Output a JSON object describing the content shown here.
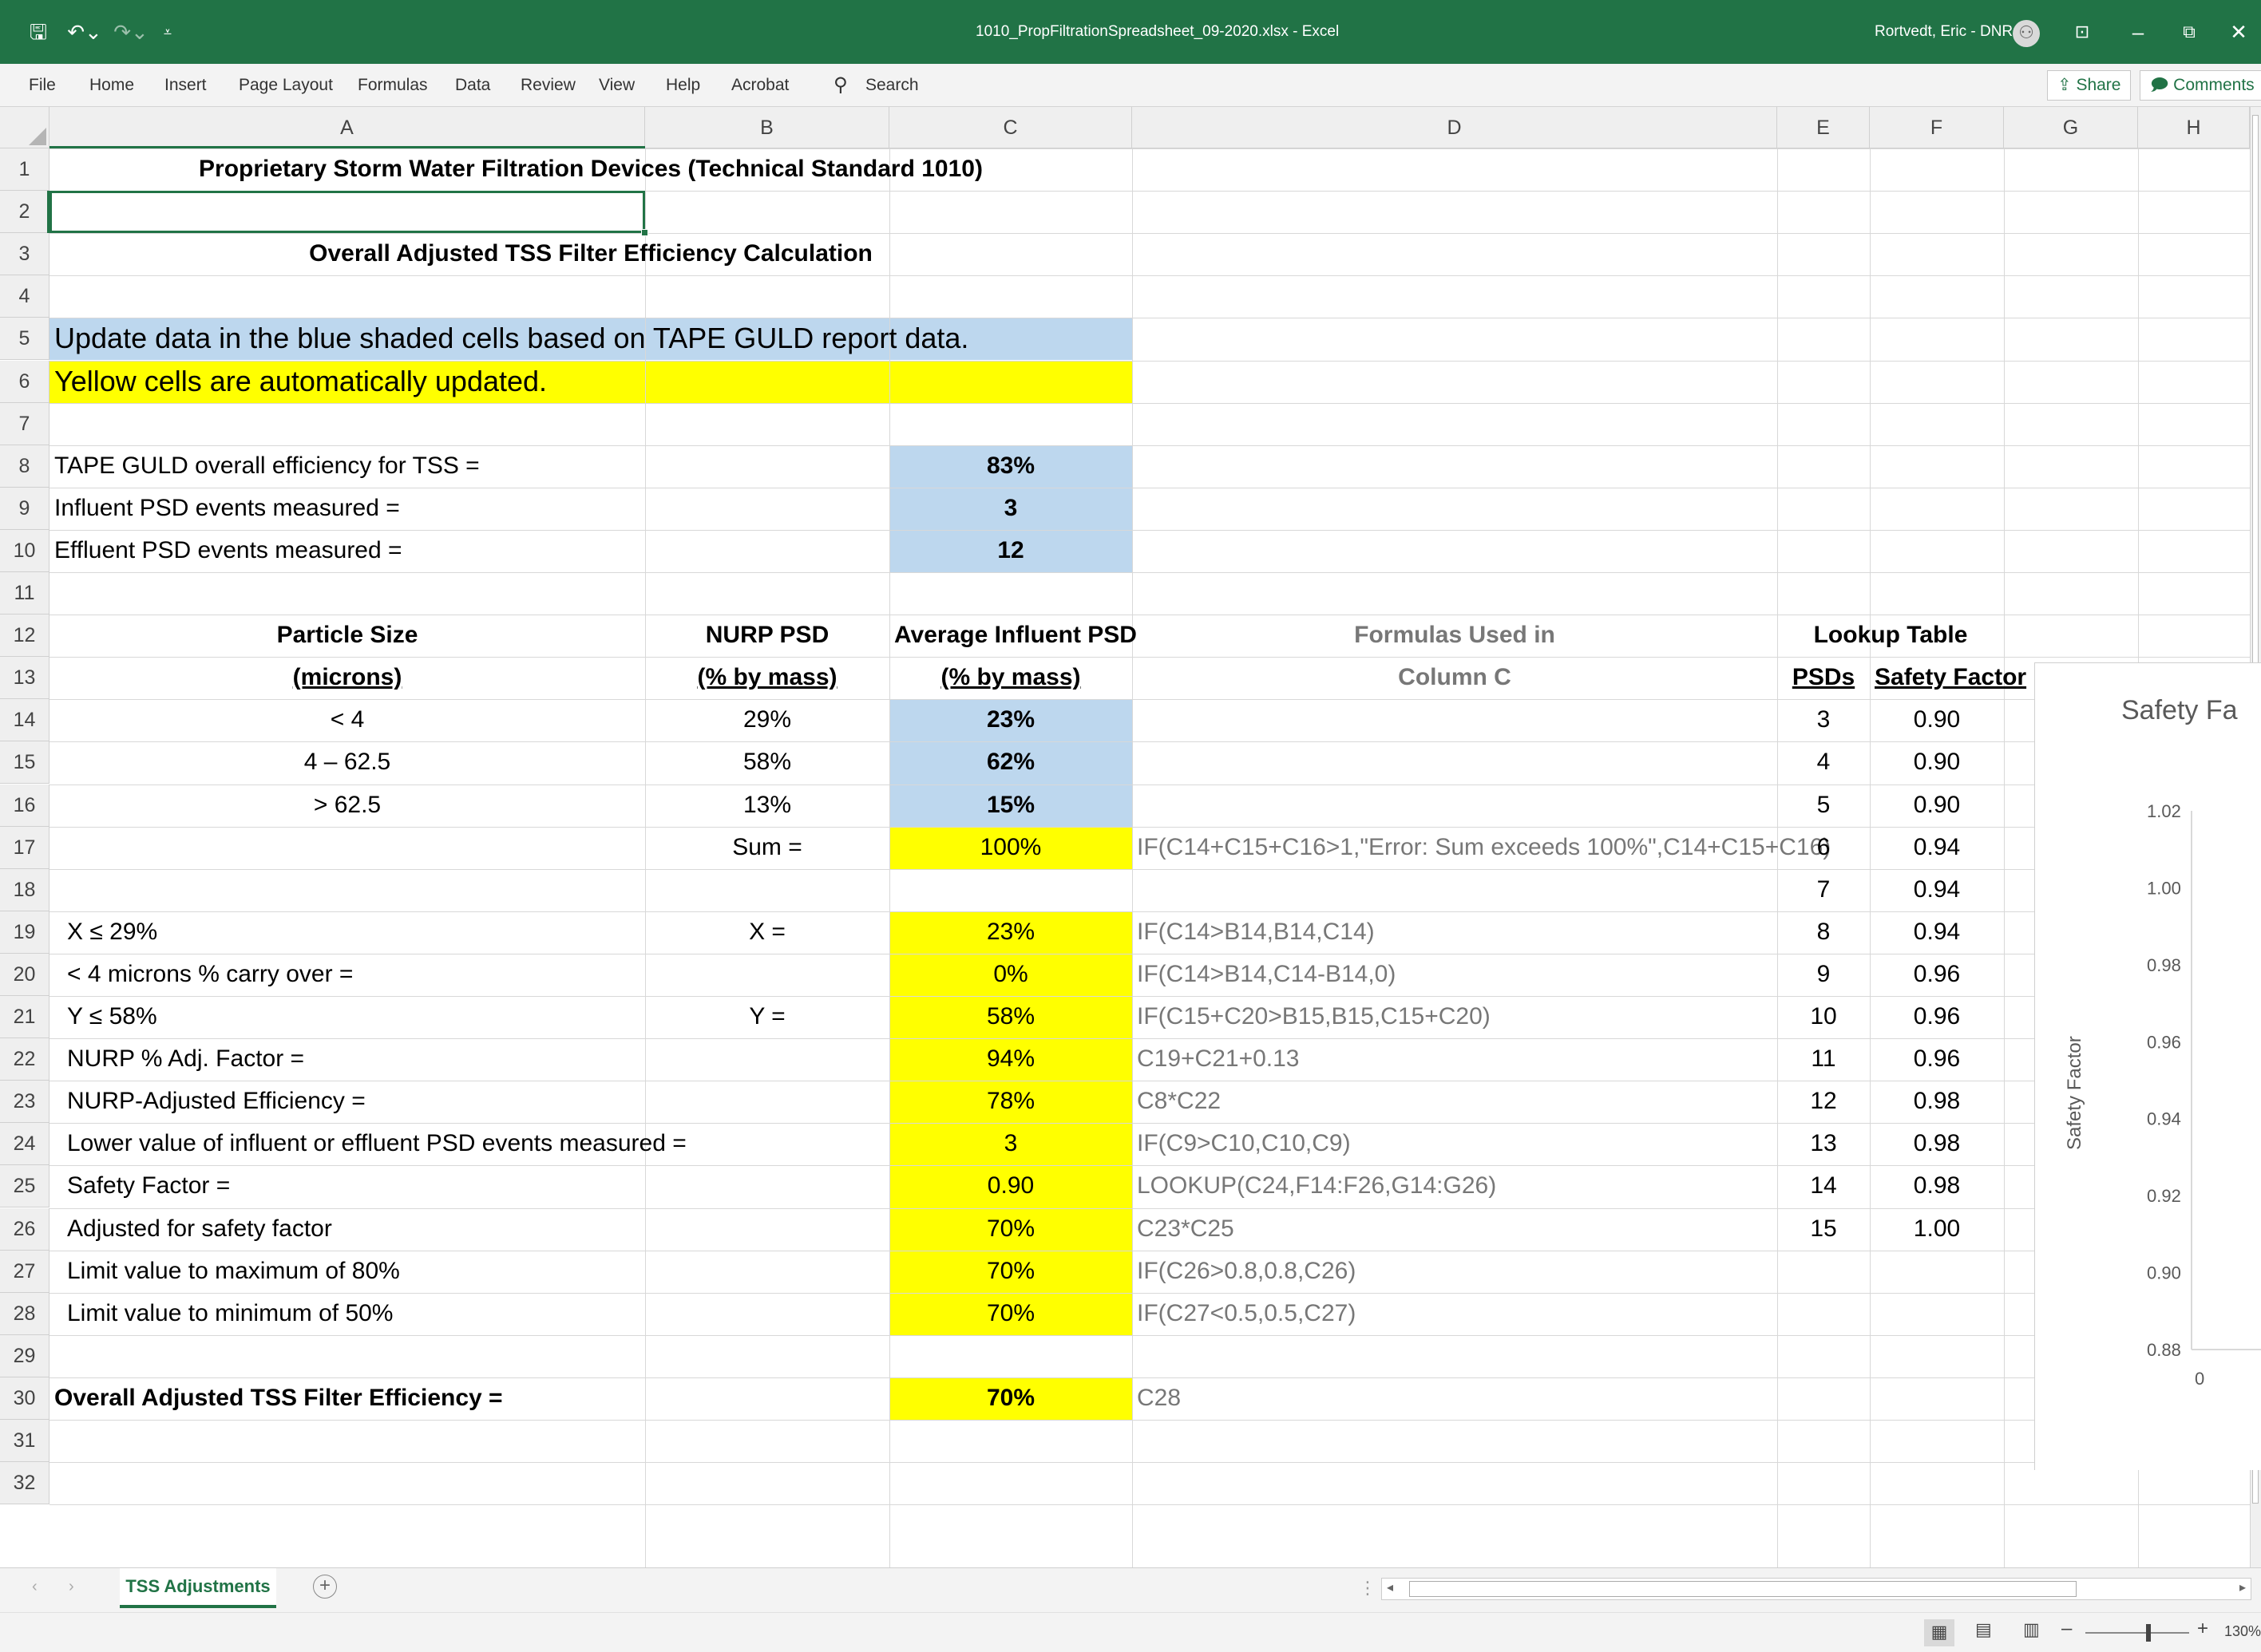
{
  "app": {
    "title": "1010_PropFiltrationSpreadsheet_09-2020.xlsx  -  Excel",
    "user": "Rortvedt, Eric - DNR",
    "accent": "#217346"
  },
  "ribbon": {
    "tabs": [
      "File",
      "Home",
      "Insert",
      "Page Layout",
      "Formulas",
      "Data",
      "Review",
      "View",
      "Help",
      "Acrobat"
    ],
    "search": "Search",
    "share": "Share",
    "comments": "Comments"
  },
  "columns": [
    "A",
    "B",
    "C",
    "D",
    "E",
    "F",
    "G",
    "H"
  ],
  "rows": [
    "1",
    "2",
    "3",
    "4",
    "5",
    "6",
    "7",
    "8",
    "9",
    "10",
    "11",
    "12",
    "13",
    "14",
    "15",
    "16",
    "17",
    "18",
    "19",
    "20",
    "21",
    "22",
    "23",
    "24",
    "25",
    "26",
    "27",
    "28",
    "29",
    "30",
    "31",
    "32"
  ],
  "sheet": {
    "title": "Proprietary Storm Water Filtration Devices (Technical Standard 1010)",
    "subtitle": "Overall Adjusted TSS Filter Efficiency Calculation",
    "blue_note": "Update data in the blue shaded cells based on TAPE GULD report data.",
    "yellow_note": "Yellow cells are automatically updated.",
    "inputs": [
      {
        "label": "TAPE GULD overall efficiency for TSS =",
        "value": "83%"
      },
      {
        "label": "Influent PSD events measured =",
        "value": "3"
      },
      {
        "label": "Effluent PSD events measured =",
        "value": "12"
      }
    ],
    "headers": {
      "a1": "Particle Size",
      "a2": "(microns)",
      "b1": "NURP PSD",
      "b2": "(% by mass)",
      "c1": "Average Influent PSD",
      "c2": "(% by mass)",
      "d1": "Formulas Used in",
      "d2": "Column C",
      "lookup": "Lookup Table",
      "psds": "PSDs",
      "sf": "Safety Factor"
    },
    "psd_rows": [
      {
        "size": "< 4",
        "nurp": "29%",
        "avg": "23%"
      },
      {
        "size": "4 – 62.5",
        "nurp": "58%",
        "avg": "62%"
      },
      {
        "size": "> 62.5",
        "nurp": "13%",
        "avg": "15%"
      }
    ],
    "sum": {
      "label": "Sum =",
      "value": "100%",
      "formula": "IF(C14+C15+C16>1,\"Error: Sum exceeds 100%\",C14+C15+C16)"
    },
    "calc": [
      {
        "row": 19,
        "label": "X ≤ 29%",
        "b": "X =",
        "value": "23%",
        "formula": "IF(C14>B14,B14,C14)",
        "bold": false
      },
      {
        "row": 20,
        "label": "< 4 microns % carry over =",
        "b": "",
        "value": "0%",
        "formula": "IF(C14>B14,C14-B14,0)",
        "bold": false
      },
      {
        "row": 21,
        "label": "Y ≤ 58%",
        "b": "Y =",
        "value": "58%",
        "formula": "IF(C15+C20>B15,B15,C15+C20)",
        "bold": false
      },
      {
        "row": 22,
        "label": "NURP % Adj. Factor =",
        "b": "",
        "value": "94%",
        "formula": "C19+C21+0.13",
        "bold": false
      },
      {
        "row": 23,
        "label": "NURP-Adjusted Efficiency =",
        "b": "",
        "value": "78%",
        "formula": "C8*C22",
        "bold": false
      },
      {
        "row": 24,
        "label": "Lower value of influent or effluent PSD events measured =",
        "b": "",
        "value": "3",
        "formula": "IF(C9>C10,C10,C9)",
        "bold": false
      },
      {
        "row": 25,
        "label": "Safety Factor =",
        "b": "",
        "value": "0.90",
        "formula": "LOOKUP(C24,F14:F26,G14:G26)",
        "bold": false
      },
      {
        "row": 26,
        "label": "Adjusted for safety factor",
        "b": "",
        "value": "70%",
        "formula": "C23*C25",
        "bold": false
      },
      {
        "row": 27,
        "label": "Limit value to maximum of 80%",
        "b": "",
        "value": "70%",
        "formula": "IF(C26>0.8,0.8,C26)",
        "bold": false
      },
      {
        "row": 28,
        "label": "Limit value to minimum of 50%",
        "b": "",
        "value": "70%",
        "formula": "IF(C27<0.5,0.5,C27)",
        "bold": false
      },
      {
        "row": 30,
        "label": "Overall Adjusted TSS Filter Efficiency =",
        "b": "",
        "value": "70%",
        "formula": "C28",
        "bold": true
      }
    ],
    "lookup": [
      {
        "psds": "3",
        "sf": "0.90"
      },
      {
        "psds": "4",
        "sf": "0.90"
      },
      {
        "psds": "5",
        "sf": "0.90"
      },
      {
        "psds": "6",
        "sf": "0.94"
      },
      {
        "psds": "7",
        "sf": "0.94"
      },
      {
        "psds": "8",
        "sf": "0.94"
      },
      {
        "psds": "9",
        "sf": "0.96"
      },
      {
        "psds": "10",
        "sf": "0.96"
      },
      {
        "psds": "11",
        "sf": "0.96"
      },
      {
        "psds": "12",
        "sf": "0.98"
      },
      {
        "psds": "13",
        "sf": "0.98"
      },
      {
        "psds": "14",
        "sf": "0.98"
      },
      {
        "psds": "15",
        "sf": "1.00"
      }
    ]
  },
  "chart_data": {
    "type": "scatter",
    "title": "Safety Fa",
    "ylabel": "Safety Factor",
    "ylim": [
      0.88,
      1.02
    ],
    "yticks": [
      "1.02",
      "1.00",
      "0.98",
      "0.96",
      "0.94",
      "0.92",
      "0.90",
      "0.88"
    ],
    "xticks": [
      "0"
    ]
  },
  "tabs": {
    "active": "TSS Adjustments"
  },
  "status": {
    "zoom": "130%"
  }
}
